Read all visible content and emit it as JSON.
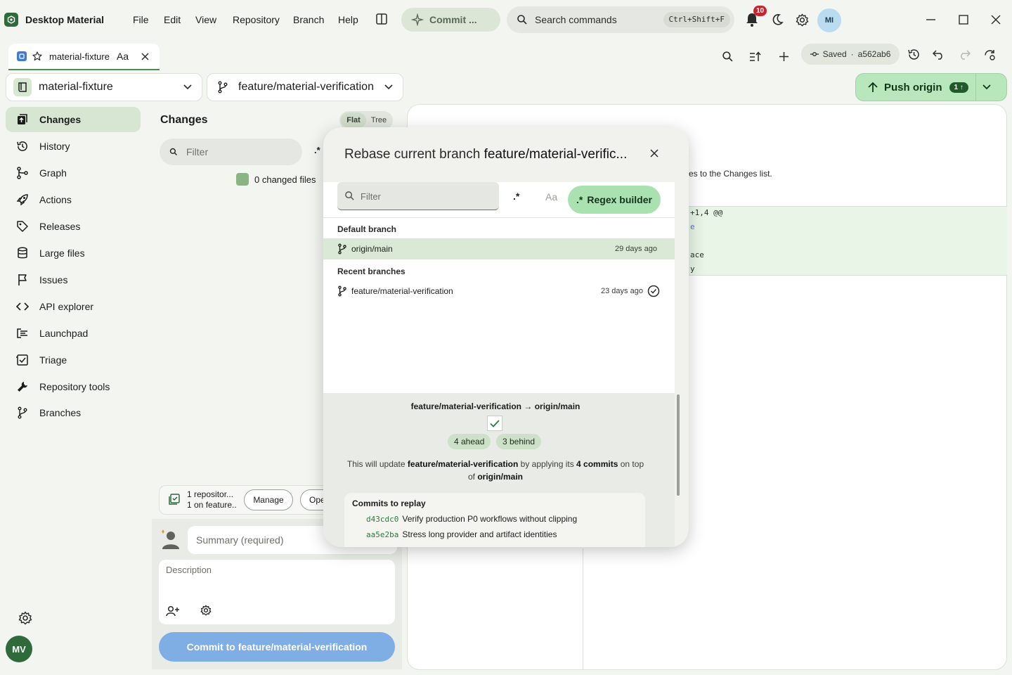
{
  "app": {
    "title": "Desktop Material"
  },
  "menu": [
    "File",
    "Edit",
    "View",
    "Repository",
    "Branch",
    "Help"
  ],
  "commit_pill": "Commit ...",
  "command_search": {
    "placeholder": "Search commands",
    "shortcut": "Ctrl+Shift+F"
  },
  "notifications": {
    "count": "10"
  },
  "user_avatar": "MI",
  "tab": {
    "label": "material-fixture",
    "case_label": "Aa"
  },
  "saved": {
    "label": "Saved",
    "sha": "a562ab6"
  },
  "repo_selector": {
    "label": "material-fixture"
  },
  "branch_selector": {
    "label": "feature/material-verification"
  },
  "push": {
    "label": "Push origin",
    "count": "1"
  },
  "sidebar": {
    "items": [
      {
        "label": "Changes",
        "icon": "changes-icon"
      },
      {
        "label": "History",
        "icon": "history-icon"
      },
      {
        "label": "Graph",
        "icon": "graph-icon"
      },
      {
        "label": "Actions",
        "icon": "rocket-icon"
      },
      {
        "label": "Releases",
        "icon": "tag-icon"
      },
      {
        "label": "Large files",
        "icon": "database-icon"
      },
      {
        "label": "Issues",
        "icon": "flag-icon"
      },
      {
        "label": "API explorer",
        "icon": "code-icon"
      },
      {
        "label": "Launchpad",
        "icon": "launchpad-icon"
      },
      {
        "label": "Triage",
        "icon": "triage-icon"
      },
      {
        "label": "Repository tools",
        "icon": "wrench-icon"
      },
      {
        "label": "Branches",
        "icon": "branch-icon"
      }
    ],
    "bottom_avatar": "MV"
  },
  "changes": {
    "title": "Changes",
    "view_flat": "Flat",
    "view_tree": "Tree",
    "filter_placeholder": "Filter",
    "changed_files": "0 changed files"
  },
  "repo_footer": {
    "line1": "1 repositor...",
    "line2": "1 on feature...",
    "manage": "Manage",
    "open": "Ope"
  },
  "commit": {
    "summary_placeholder": "Summary (required)",
    "description_placeholder": "Description",
    "button": "Commit to feature/material-verification"
  },
  "diff": {
    "hint": "es to the Changes list.",
    "lines": [
      "+1,4 @@",
      "e",
      "",
      "ace",
      "y"
    ]
  },
  "rebase_modal": {
    "title_prefix": "Rebase current branch",
    "title_branch": "feature/material-verific...",
    "filter_placeholder": "Filter",
    "regex_toggle": ".*",
    "case_toggle": "Aa",
    "regex_builder_icon": ".*",
    "regex_builder": "Regex builder",
    "default_branch_heading": "Default branch",
    "default_branch": {
      "name": "origin/main",
      "age": "29 days ago"
    },
    "recent_heading": "Recent branches",
    "recent_branches": [
      {
        "name": "feature/material-verification",
        "age": "23 days ago"
      }
    ],
    "summary": {
      "from": "feature/material-verification",
      "arrow": "→",
      "to": "origin/main",
      "ahead": "4 ahead",
      "behind": "3 behind",
      "desc_1": "This will update",
      "desc_branch": "feature/material-verification",
      "desc_2": "by applying its",
      "desc_commits": "4 commits",
      "desc_3": "on top of",
      "desc_target": "origin/main"
    },
    "replay_title": "Commits to replay",
    "commits": [
      {
        "sha": "d43cdc0",
        "message": "Verify production P0 workflows without clipping"
      },
      {
        "sha": "aa5e2ba",
        "message": "Stress long provider and artifact identities"
      }
    ]
  },
  "colors": {
    "accent": "#2f6a3b",
    "push_bg": "#b8e7bc",
    "selected_row": "#d9e9d5",
    "commit_button": "#7eaee3",
    "badge": "#c8242b"
  }
}
